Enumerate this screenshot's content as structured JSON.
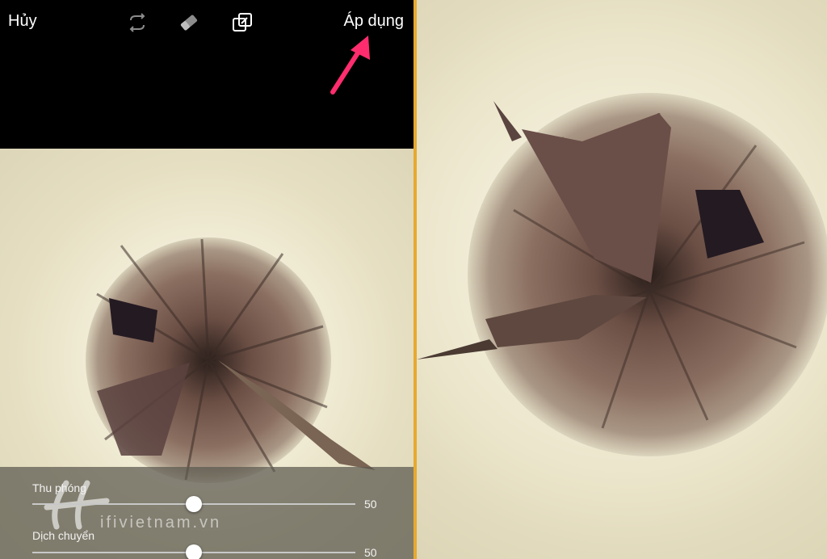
{
  "toolbar": {
    "cancel_label": "Hủy",
    "apply_label": "Áp dụng",
    "icons": [
      "rotate-icon",
      "eraser-icon",
      "crop-icon"
    ]
  },
  "controls": {
    "zoom": {
      "label": "Thu phóng",
      "value": "50"
    },
    "shift": {
      "label": "Dịch chuyển",
      "value": "50"
    }
  },
  "watermark": {
    "text": "ifivietnam.vn"
  },
  "colors": {
    "accent_arrow": "#ff2d6e",
    "divider": "#e7a92f"
  }
}
